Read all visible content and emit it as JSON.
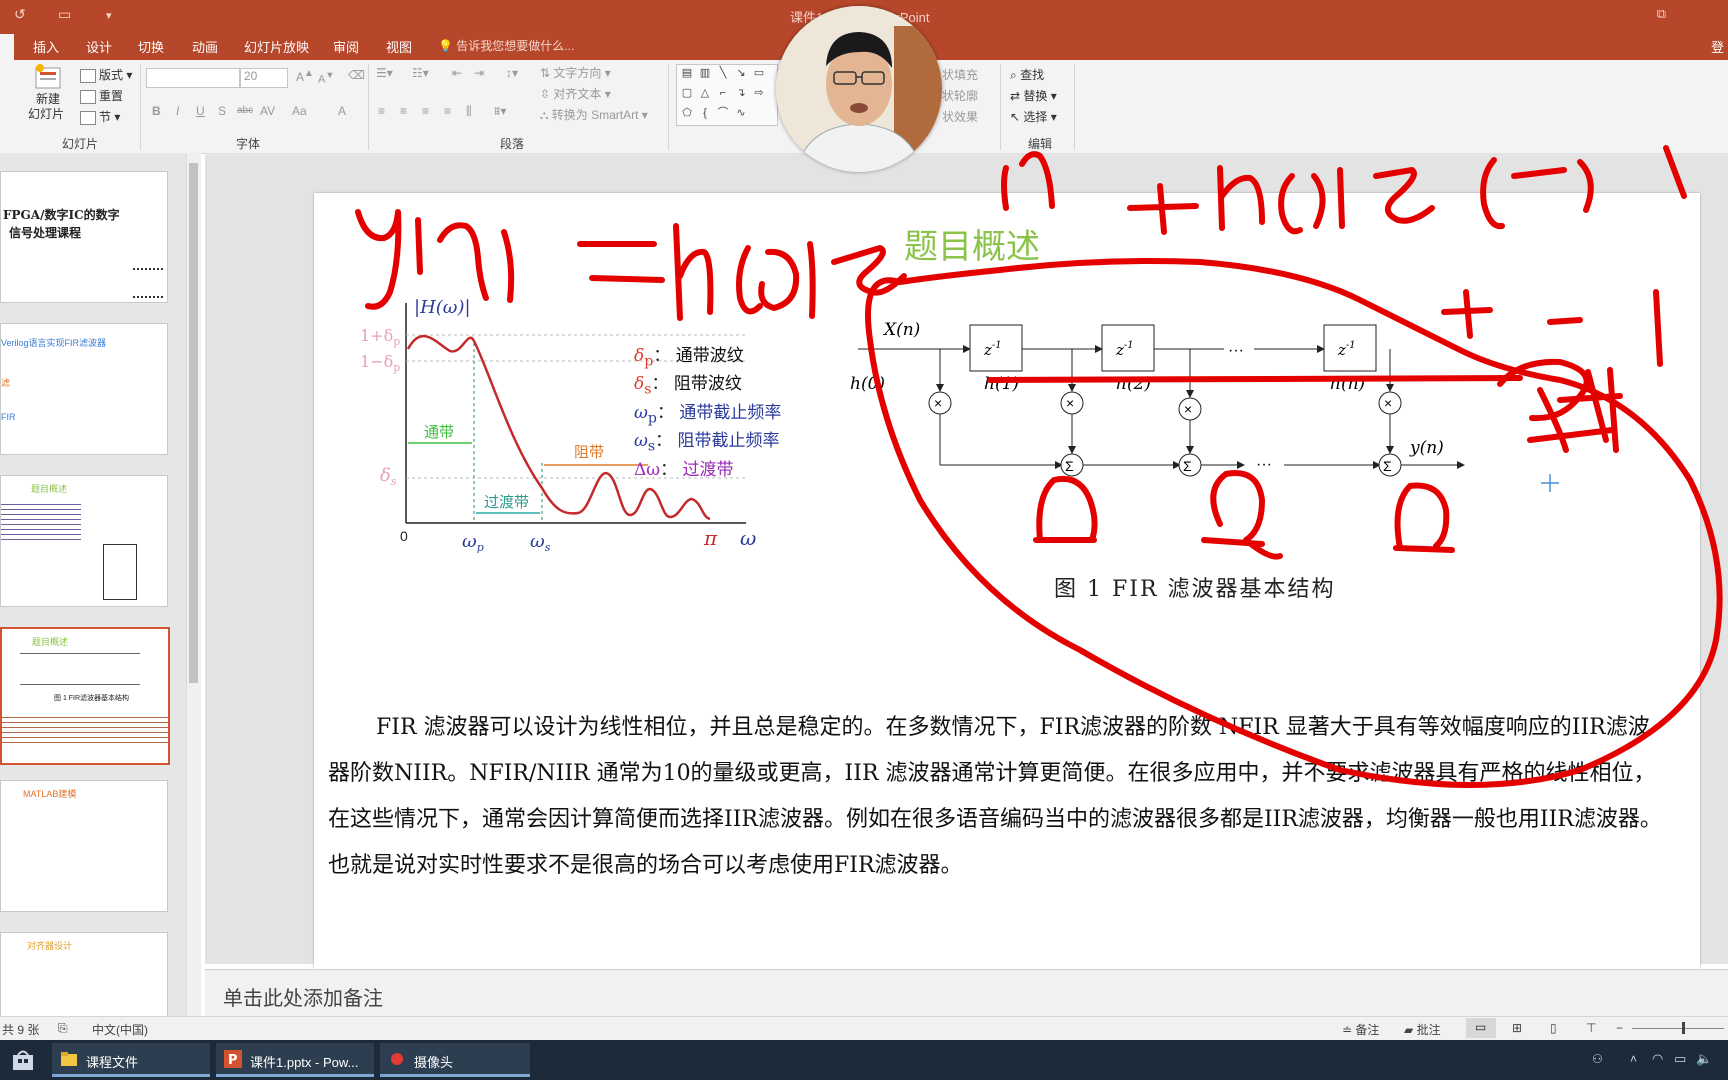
{
  "window": {
    "title": "课件1.pptx - PowerPoint",
    "restore_glyph": "⧉",
    "login": "登"
  },
  "quick_access": {
    "undo": "↺",
    "customize": "▾"
  },
  "tabs": {
    "insert": "插入",
    "design": "设计",
    "transitions": "切换",
    "animations": "动画",
    "slideshow": "幻灯片放映",
    "review": "审阅",
    "view": "视图",
    "tell_me": "告诉我您想要做什么..."
  },
  "ribbon": {
    "slides_group": {
      "new_slide": "新建",
      "new_slide2": "幻灯片",
      "layout": "版式",
      "reset": "重置",
      "section": "节",
      "label": "幻灯片"
    },
    "font_group": {
      "font_size": "20",
      "label": "字体",
      "bold": "B",
      "italic": "I",
      "underline": "U",
      "shadow": "S",
      "strike": "abc",
      "spacing": "AV",
      "case": "Aa",
      "color": "A"
    },
    "paragraph_group": {
      "text_direction": "文字方向",
      "align_text": "对齐文本",
      "smartart": "转换为 SmartArt",
      "label": "段落"
    },
    "drawing_group": {
      "fill": "状填充",
      "outline": "状轮廓",
      "effects": "状效果"
    },
    "editing_group": {
      "find": "查找",
      "replace": "替换",
      "select": "选择",
      "label": "编辑"
    }
  },
  "thumbnails": [
    {
      "line1": "FPGA/数字IC的数字",
      "line2": "信号处理课程"
    },
    {
      "line1": "Verilog语言实现FIR滤波器",
      "line2": "滤",
      "line3": "FIR"
    },
    {
      "line1": "题目概述"
    },
    {
      "line1": "题目概述",
      "caption": "图 1  FIR滤波器基本结构"
    },
    {
      "line1": "MATLAB建模"
    },
    {
      "line1": "对齐器设计"
    }
  ],
  "slide": {
    "title": "题目概述",
    "figure_caption": "图 1   FIR 滤波器基本结构",
    "paragraph": "FIR 滤波器可以设计为线性相位，并且总是稳定的。在多数情况下，FIR滤波器的阶数 NFIR 显著大于具有等效幅度响应的IIR滤波器阶数NIIR。NFIR/NIIR 通常为10的量级或更高，IIR 滤波器通常计算更简便。在很多应用中，并不要求滤波器具有严格的线性相位，在这些情况下，通常会因计算简便而选择IIR滤波器。例如在很多语音编码当中的滤波器很多都是IIR滤波器，均衡器一般也用IIR滤波器。也就是说对实时性要求不是很高的场合可以考虑使用FIR滤波器。",
    "response_plot": {
      "y_axis": "|H(ω)|",
      "y_tick1": "1+δ",
      "y_tick1_sub": "p",
      "y_tick2": "1−δ",
      "y_tick2_sub": "p",
      "y_tick3": "δ",
      "y_tick3_sub": "s",
      "x0": "0",
      "wp": "ω",
      "wp_sub": "p",
      "ws": "ω",
      "ws_sub": "s",
      "pi": "π",
      "omega": "ω",
      "passband": "通带",
      "transition": "过渡带",
      "stopband": "阻带",
      "legend": [
        {
          "sym": "δ",
          "sub": "p",
          "text": "通带波纹",
          "color": "#e03c2a"
        },
        {
          "sym": "δ",
          "sub": "s",
          "text": "阻带波纹",
          "color": "#e03c2a"
        },
        {
          "sym": "ω",
          "sub": "p",
          "text": "通带截止频率",
          "color": "#2b3b9c"
        },
        {
          "sym": "ω",
          "sub": "s",
          "text": "阻带截止频率",
          "color": "#2b3b9c"
        },
        {
          "sym": "Δω",
          "sub": "",
          "text": "过渡带",
          "color": "#9b2bb8"
        }
      ]
    },
    "fir_diagram": {
      "input": "X(n)",
      "output": "y(n)",
      "delay": "z",
      "delay_sup": "-1",
      "coef0": "h(0)",
      "coef1": "h(1)",
      "coef2": "h(2)",
      "coefn": "h(n)",
      "mult": "×",
      "sum": "Σ",
      "dots": "···"
    }
  },
  "notes": {
    "placeholder": "单击此处添加备注"
  },
  "status": {
    "slide_count": "共 9 张",
    "language": "中文(中国)",
    "notes_btn": "备注",
    "comments_btn": "批注"
  },
  "taskbar": [
    {
      "label": "课程文件"
    },
    {
      "label": "课件1.pptx - Pow..."
    },
    {
      "label": "摄像头"
    }
  ],
  "colors": {
    "accent": "#b7472a",
    "ink": "#e50000",
    "selected_thumb": "#d35230"
  }
}
